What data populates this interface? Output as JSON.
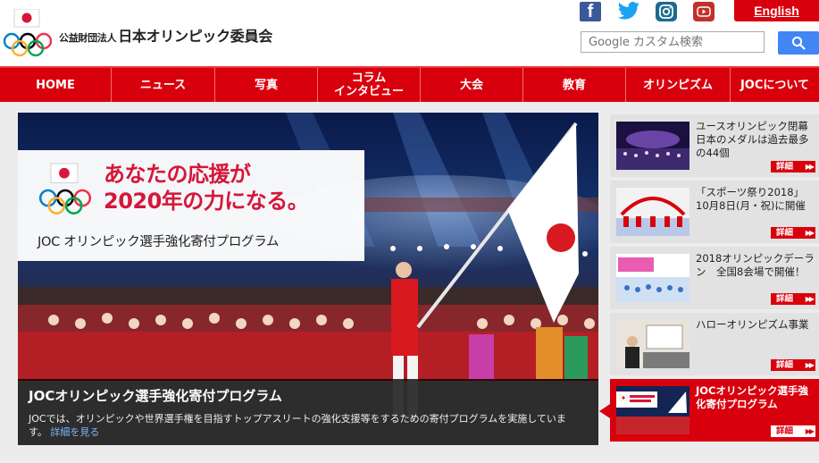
{
  "header": {
    "org_prefix": "公益財団法人",
    "org_name": "日本オリンピック委員会",
    "english_label": "English",
    "search_placeholder": "Google カスタム検索",
    "social": [
      "facebook-icon",
      "twitter-icon",
      "instagram-icon",
      "youtube-icon"
    ]
  },
  "nav": {
    "items": [
      {
        "label": "HOME"
      },
      {
        "label": "ニュース"
      },
      {
        "label": "写真"
      },
      {
        "label": "コラム\nインタビュー"
      },
      {
        "label": "大会"
      },
      {
        "label": "教育"
      },
      {
        "label": "オリンピズム"
      },
      {
        "label": "JOCについて"
      }
    ]
  },
  "hero": {
    "banner_headline": "あなたの応援が\n2020年の力になる。",
    "banner_sub": "JOC オリンピック選手強化寄付プログラム",
    "caption_title": "JOCオリンピック選手強化寄付プログラム",
    "caption_desc": "JOCでは、オリンピックや世界選手権を目指すトップアスリートの強化支援等をするための寄付プログラムを実施しています。",
    "caption_link": "詳細を見る"
  },
  "side": {
    "detail_label": "詳細",
    "detail_arrows": "▶▶",
    "items": [
      {
        "text": "ユースオリンピック閉幕 日本のメダルは過去最多の44個"
      },
      {
        "text": "「スポーツ祭り2018」 10月8日(月・祝)に開催"
      },
      {
        "text": "2018オリンピックデーラン　全国8会場で開催！"
      },
      {
        "text": "ハローオリンピズム事業"
      },
      {
        "text": "JOCオリンピック選手強化寄付プログラム"
      }
    ]
  },
  "colors": {
    "brand_red": "#d9000d",
    "search_blue": "#4285f4",
    "facebook": "#3b5998",
    "twitter": "#1da1f2"
  }
}
